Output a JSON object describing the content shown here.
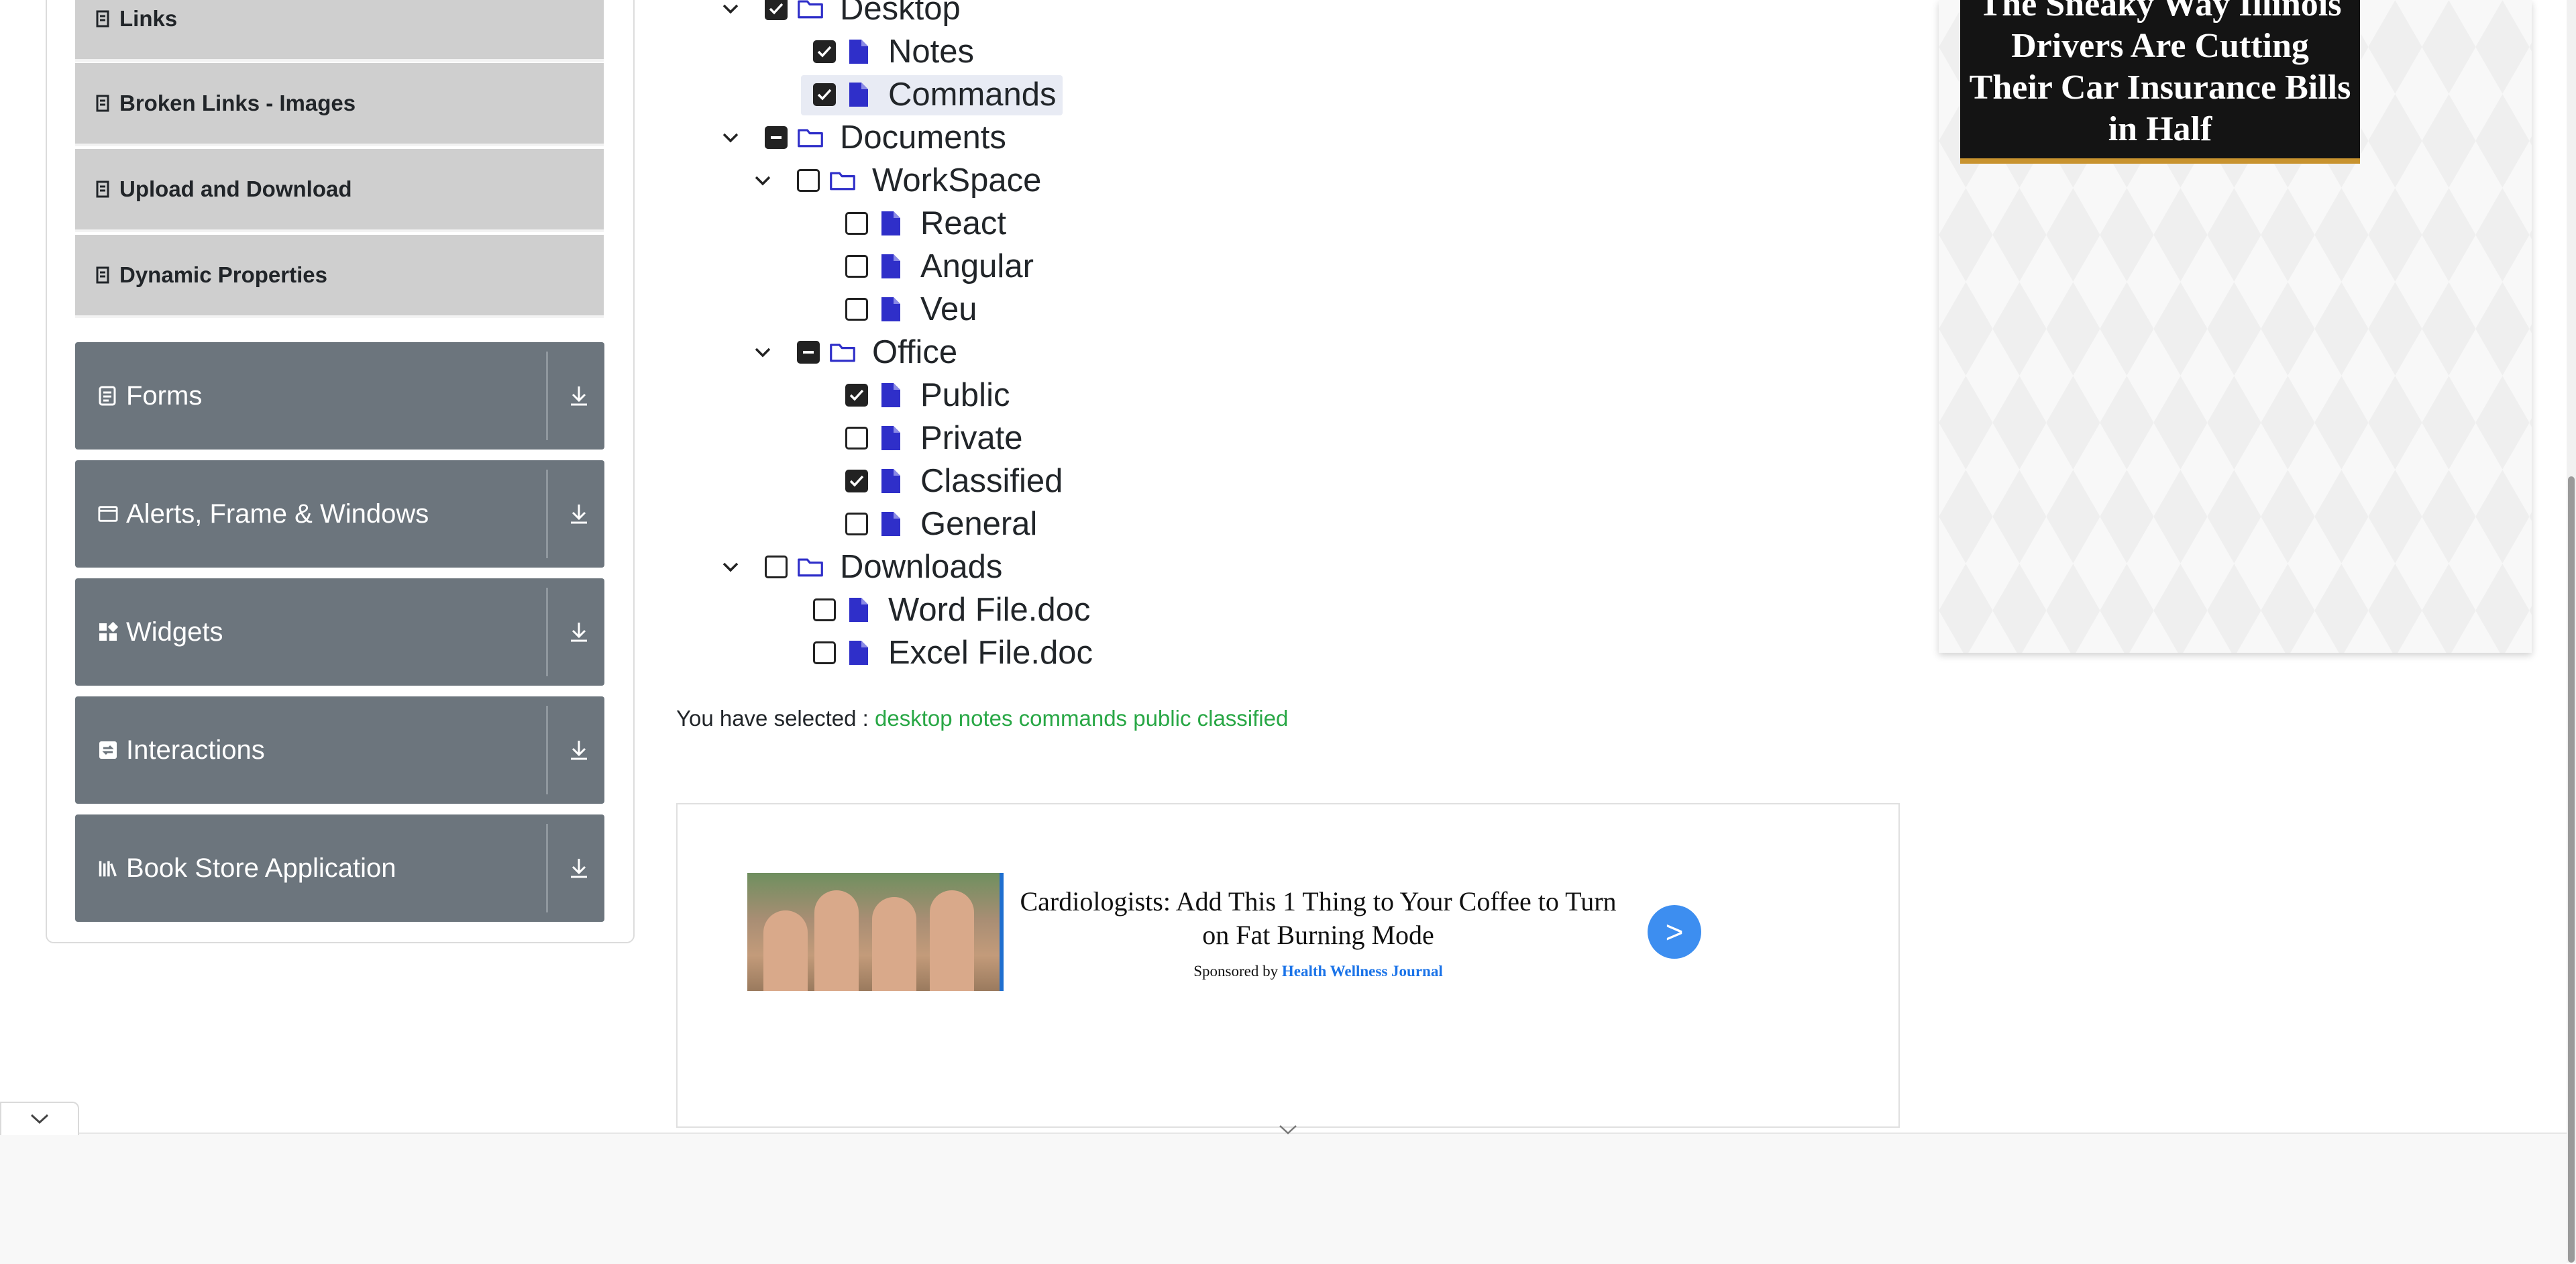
{
  "sidebar": {
    "sub_items": [
      {
        "label": "Links",
        "icon": "list-icon"
      },
      {
        "label": "Broken Links - Images",
        "icon": "list-icon"
      },
      {
        "label": "Upload and Download",
        "icon": "list-icon"
      },
      {
        "label": "Dynamic Properties",
        "icon": "list-icon"
      }
    ],
    "groups": [
      {
        "label": "Forms",
        "icon": "form-icon"
      },
      {
        "label": "Alerts, Frame & Windows",
        "icon": "window-icon"
      },
      {
        "label": "Widgets",
        "icon": "widgets-icon"
      },
      {
        "label": "Interactions",
        "icon": "interactions-icon"
      },
      {
        "label": "Book Store Application",
        "icon": "books-icon"
      }
    ]
  },
  "tree": {
    "nodes": [
      {
        "label": "Desktop",
        "type": "folder",
        "state": "checked",
        "expanded": true
      },
      {
        "label": "Notes",
        "type": "file",
        "state": "checked"
      },
      {
        "label": "Commands",
        "type": "file",
        "state": "checked",
        "highlighted": true
      },
      {
        "label": "Documents",
        "type": "folder",
        "state": "half",
        "expanded": true
      },
      {
        "label": "WorkSpace",
        "type": "folder",
        "state": "unchecked",
        "expanded": true
      },
      {
        "label": "React",
        "type": "file",
        "state": "unchecked"
      },
      {
        "label": "Angular",
        "type": "file",
        "state": "unchecked"
      },
      {
        "label": "Veu",
        "type": "file",
        "state": "unchecked"
      },
      {
        "label": "Office",
        "type": "folder",
        "state": "half",
        "expanded": true
      },
      {
        "label": "Public",
        "type": "file",
        "state": "checked"
      },
      {
        "label": "Private",
        "type": "file",
        "state": "unchecked"
      },
      {
        "label": "Classified",
        "type": "file",
        "state": "checked"
      },
      {
        "label": "General",
        "type": "file",
        "state": "unchecked"
      },
      {
        "label": "Downloads",
        "type": "folder",
        "state": "unchecked",
        "expanded": true
      },
      {
        "label": "Word File.doc",
        "type": "file",
        "state": "unchecked"
      },
      {
        "label": "Excel File.doc",
        "type": "file",
        "state": "unchecked"
      }
    ]
  },
  "result": {
    "prefix": "You have selected :",
    "selected": "desktop notes commands public classified"
  },
  "ad": {
    "headline": "Cardiologists: Add This 1 Thing to Your Coffee to Turn on Fat Burning Mode",
    "sponsor_prefix": "Sponsored by",
    "sponsor_name": "Health Wellness Journal",
    "arrow": ">"
  },
  "side_ad": {
    "title": "The Sneaky Way Illinois Drivers Are Cutting Their Car Insurance Bills in Half"
  },
  "colors": {
    "sidebar_group_bg": "#6c757d",
    "sidebar_sub_bg": "#cfcfcf",
    "tree_icon": "#2f2fc9",
    "selection_text": "#28a745",
    "ad_button": "#3d8ef0"
  }
}
